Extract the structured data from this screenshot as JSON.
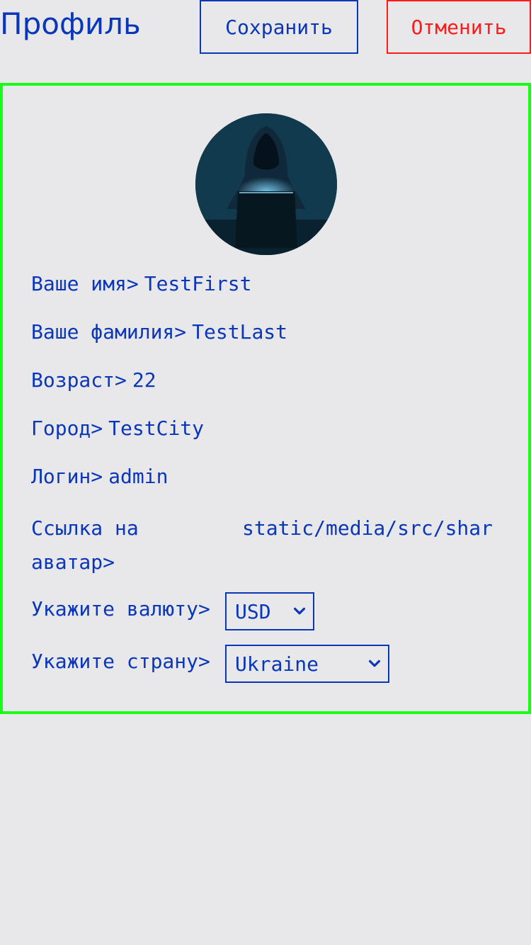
{
  "header": {
    "title": "Профиль",
    "save_label": "Сохранить",
    "cancel_label": "Отменить"
  },
  "colors": {
    "accent": "#0a36b8",
    "danger": "#ff1a1a",
    "card_border": "#17ff17",
    "background": "#e8e8eb"
  },
  "profile": {
    "fields": [
      {
        "label": "Ваше имя>",
        "value": "TestFirst"
      },
      {
        "label": "Ваше фамилия>",
        "value": "TestLast"
      },
      {
        "label": "Возраст>",
        "value": "22"
      },
      {
        "label": "Город>",
        "value": "TestCity"
      },
      {
        "label": "Логин>",
        "value": "admin"
      }
    ],
    "avatar_link": {
      "label": "Ссылка на аватар>",
      "value": "static/media/src/shar"
    },
    "currency": {
      "label": "Укажите валюту>",
      "selected": "USD"
    },
    "country": {
      "label": "Укажите страну>",
      "selected": "Ukraine"
    }
  },
  "icons": {
    "select_arrow": "chevron-down-icon",
    "avatar": "hooded-figure-laptop-image"
  }
}
